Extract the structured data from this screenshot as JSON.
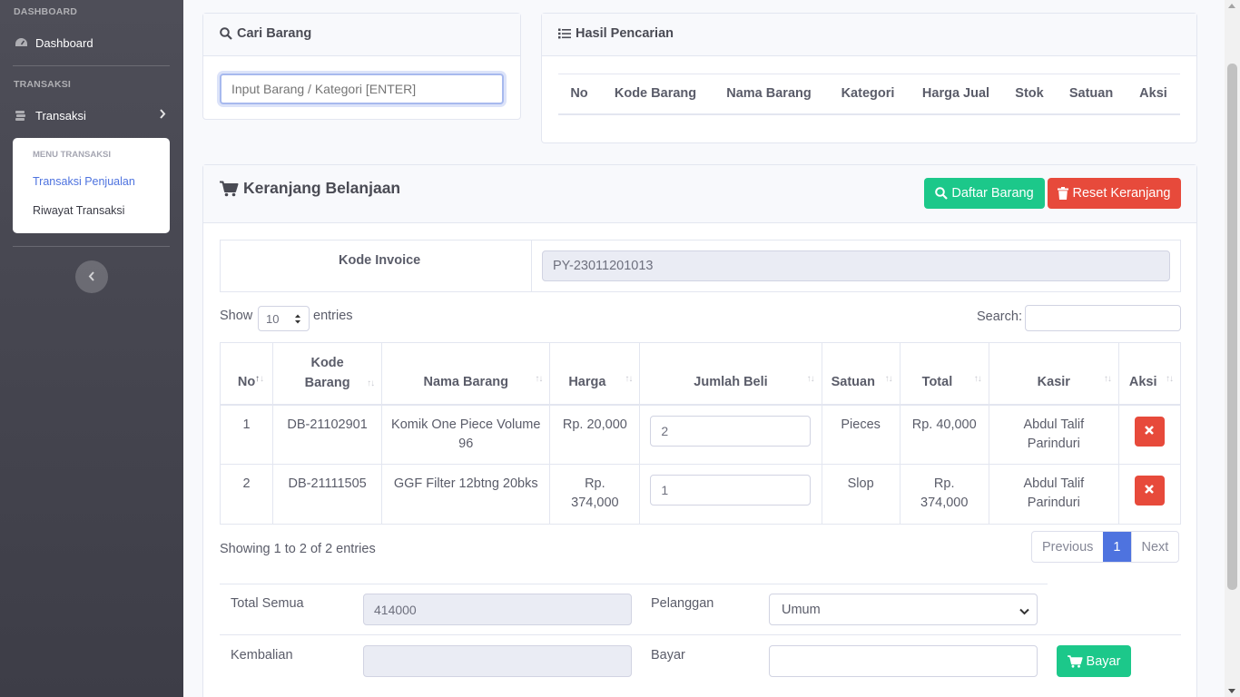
{
  "sidebar": {
    "heading_dashboard": "DASHBOARD",
    "dashboard_label": "Dashboard",
    "heading_transaksi": "TRANSAKSI",
    "transaksi_label": "Transaksi",
    "submenu_heading": "MENU TRANSAKSI",
    "submenu_items": [
      "Transaksi Penjualan",
      "Riwayat Transaksi"
    ],
    "accent_color": "#4e73df"
  },
  "search_card": {
    "title": "Cari Barang",
    "input_placeholder": "Input Barang / Kategori [ENTER]"
  },
  "results_card": {
    "title": "Hasil Pencarian",
    "columns": [
      "No",
      "Kode Barang",
      "Nama Barang",
      "Kategori",
      "Harga Jual",
      "Stok",
      "Satuan",
      "Aksi"
    ]
  },
  "cart": {
    "title": "Keranjang Belanjaan",
    "daftar_button": "Daftar Barang",
    "reset_button": "Reset Keranjang",
    "invoice_label": "Kode Invoice",
    "invoice_value": "PY-23011201013",
    "show_label": "Show",
    "entries_label": "entries",
    "entries_value": "10",
    "search_label": "Search:",
    "columns": [
      "No",
      "Kode Barang",
      "Nama Barang",
      "Harga",
      "Jumlah Beli",
      "Satuan",
      "Total",
      "Kasir",
      "Aksi"
    ],
    "rows": [
      {
        "no": "1",
        "kode": "DB-21102901",
        "nama": "Komik One Piece Volume 96",
        "harga": "Rp. 20,000",
        "jumlah": "2",
        "satuan": "Pieces",
        "total": "Rp. 40,000",
        "kasir": "Abdul Talif Parinduri"
      },
      {
        "no": "2",
        "kode": "DB-21111505",
        "nama": "GGF Filter 12btng 20bks",
        "harga": "Rp. 374,000",
        "jumlah": "1",
        "satuan": "Slop",
        "total": "Rp. 374,000",
        "kasir": "Abdul Talif Parinduri"
      }
    ],
    "showing_text": "Showing 1 to 2 of 2 entries",
    "pager": {
      "previous": "Previous",
      "page": "1",
      "next": "Next"
    },
    "total_semua_label": "Total Semua",
    "total_semua_value": "414000",
    "pelanggan_label": "Pelanggan",
    "pelanggan_value": "Umum",
    "kembalian_label": "Kembalian",
    "kembalian_value": "",
    "bayar_label": "Bayar",
    "bayar_value": "",
    "bayar_button": "Bayar"
  },
  "icons": [
    "tachometer-icon",
    "money-icon",
    "chevron-right-icon",
    "chevron-left-icon",
    "search-icon",
    "list-icon",
    "cart-icon",
    "trash-icon",
    "close-icon",
    "sort-icon"
  ],
  "colors": {
    "success": "#1cc88a",
    "danger": "#e74a3b",
    "primary": "#4e73df"
  }
}
